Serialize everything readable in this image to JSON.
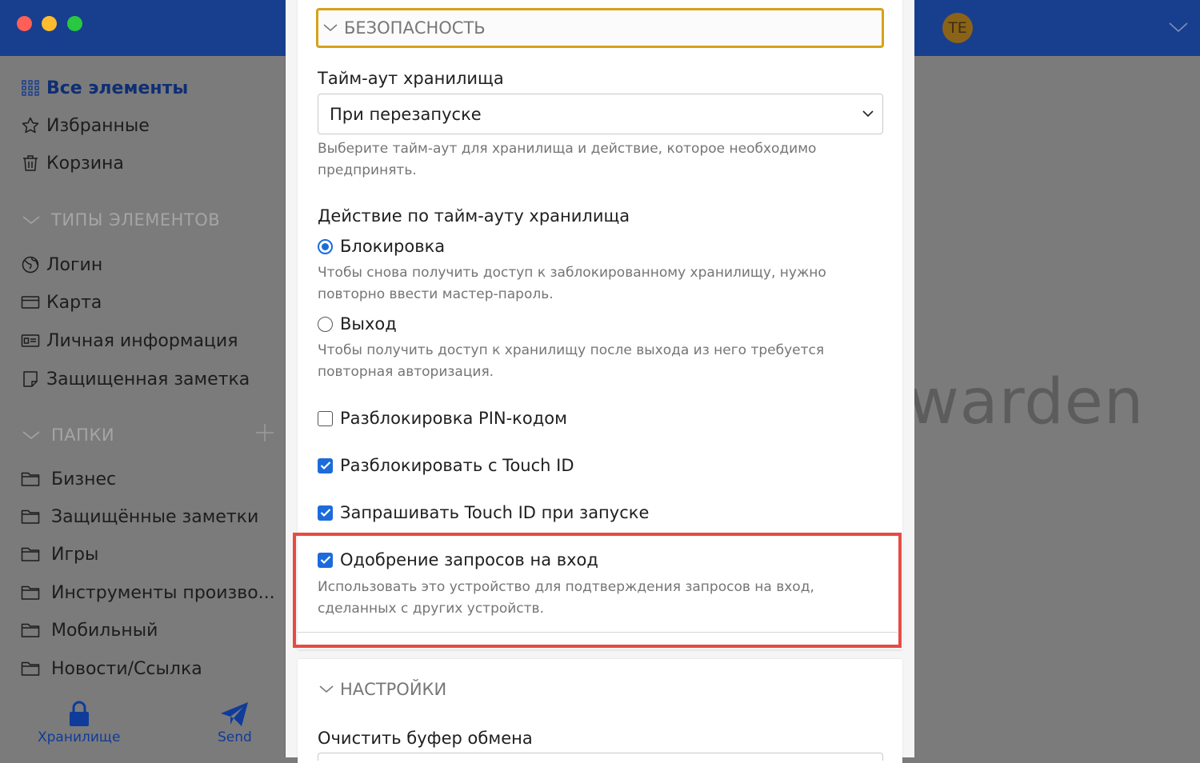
{
  "sidebar": {
    "all_items": "Все элементы",
    "favorites": "Избранные",
    "trash": "Корзина",
    "types_header": "ТИПЫ ЭЛЕМЕНТОВ",
    "types": [
      {
        "label": "Логин",
        "icon": "globe-icon"
      },
      {
        "label": "Карта",
        "icon": "credit-card-icon"
      },
      {
        "label": "Личная информация",
        "icon": "id-card-icon"
      },
      {
        "label": "Защищенная заметка",
        "icon": "sticky-note-icon"
      }
    ],
    "folders_header": "ПАПКИ",
    "folders": [
      "Бизнес",
      "Защищённые заметки",
      "Игры",
      "Инструменты произво...",
      "Мобильный",
      "Новости/Ссылка"
    ]
  },
  "bottom_nav": {
    "vault_label": "Хранилище",
    "send_label": "Send"
  },
  "account": {
    "initials": "TE",
    "avatar_color": "#8a6318"
  },
  "brand_text": "warden",
  "settings": {
    "security_header": "БЕЗОПАСНОСТЬ",
    "timeout_label": "Тайм-аут хранилища",
    "timeout_value": "При перезапуске",
    "timeout_help": "Выберите тайм-аут для хранилища и действие, которое необходимо предпринять.",
    "timeout_action_label": "Действие по тайм-ауту хранилища",
    "lock_label": "Блокировка",
    "lock_help": "Чтобы снова получить доступ к заблокированному хранилищу, нужно повторно ввести мастер-пароль.",
    "logout_label": "Выход",
    "logout_help": "Чтобы получить доступ к хранилищу после выхода из него требуется повторная авторизация.",
    "pin_unlock_label": "Разблокировка PIN-кодом",
    "touchid_unlock_label": "Разблокировать с Touch ID",
    "touchid_launch_label": "Запрашивать Touch ID при запуске",
    "approve_login_label": "Одобрение запросов на вход",
    "approve_login_help": "Использовать это устройство для подтверждения запросов на вход, сделанных с других устройств.",
    "preferences_header": "НАСТРОЙКИ",
    "clear_clipboard_label": "Очистить буфер обмена"
  },
  "colors": {
    "accent": "#1c6bdb",
    "titlebar": "#183e8e",
    "highlight": "#e84a44",
    "focus_ring": "#d7a116"
  }
}
